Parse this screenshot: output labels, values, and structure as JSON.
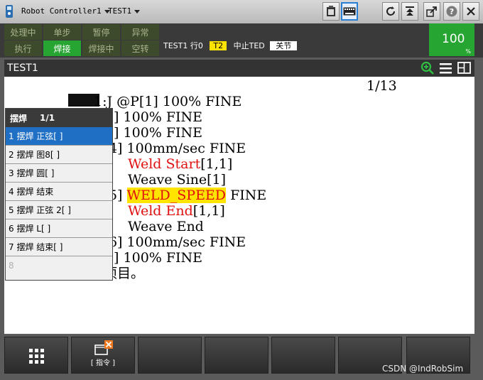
{
  "title_bar": {
    "controller": "Robot Controller1",
    "program": "TEST1",
    "icons": [
      "clipboard-icon",
      "keyboard-icon",
      "refresh-icon",
      "step-icon",
      "export-icon",
      "help-icon",
      "close-icon"
    ]
  },
  "status": {
    "leds": [
      {
        "label": "处理中",
        "state": "off"
      },
      {
        "label": "单步",
        "state": "off"
      },
      {
        "label": "暂停",
        "state": "off"
      },
      {
        "label": "异常",
        "state": "off"
      },
      {
        "label": "执行",
        "state": "off"
      },
      {
        "label": "焊接",
        "state": "on"
      },
      {
        "label": "焊接中",
        "state": "off"
      },
      {
        "label": "空转",
        "state": "off"
      }
    ],
    "line_prog": "TEST1",
    "line_row": "行0",
    "line_mode": "T2",
    "line_stop": "中止TED",
    "line_joint": "关节",
    "override": "100",
    "override_unit": "%"
  },
  "program": {
    "name": "TEST1",
    "page": "1/13",
    "lines": [
      "1:J @P[1] 100% FINE",
      "  J  P[2] 100% FINE",
      "  J  P[3] 100% FINE",
      "  L  P[4] 100mm/sec FINE",
      "Weld Start",
      "[1,1]",
      "Weave Sine[1]",
      "  L  P[5] ",
      "WELD_SPEED",
      " FINE",
      "Weld End",
      "[1,1]",
      "Weave End",
      "  L  P[6] 100mm/sec FINE",
      "  J  P[7] 100% FINE",
      "项目。"
    ]
  },
  "menu": {
    "title": "摆焊",
    "page": "1/1",
    "items": [
      "1 摆焊 正弦[ ]",
      "2 摆焊 图8[ ]",
      "3 摆焊  圆[ ]",
      "4 摆焊 结束",
      "5 摆焊 正弦 2[ ]",
      "6 摆焊 L[ ]",
      "7 摆焊 结束[ ]",
      "8"
    ]
  },
  "fkeys": {
    "f2_label": "[ 指令 ]"
  },
  "watermark": "CSDN @IndRobSim",
  "colors": {
    "green": "#27a532",
    "yellow": "#ffe400",
    "red": "#e01010",
    "select": "#1f6fc5"
  }
}
